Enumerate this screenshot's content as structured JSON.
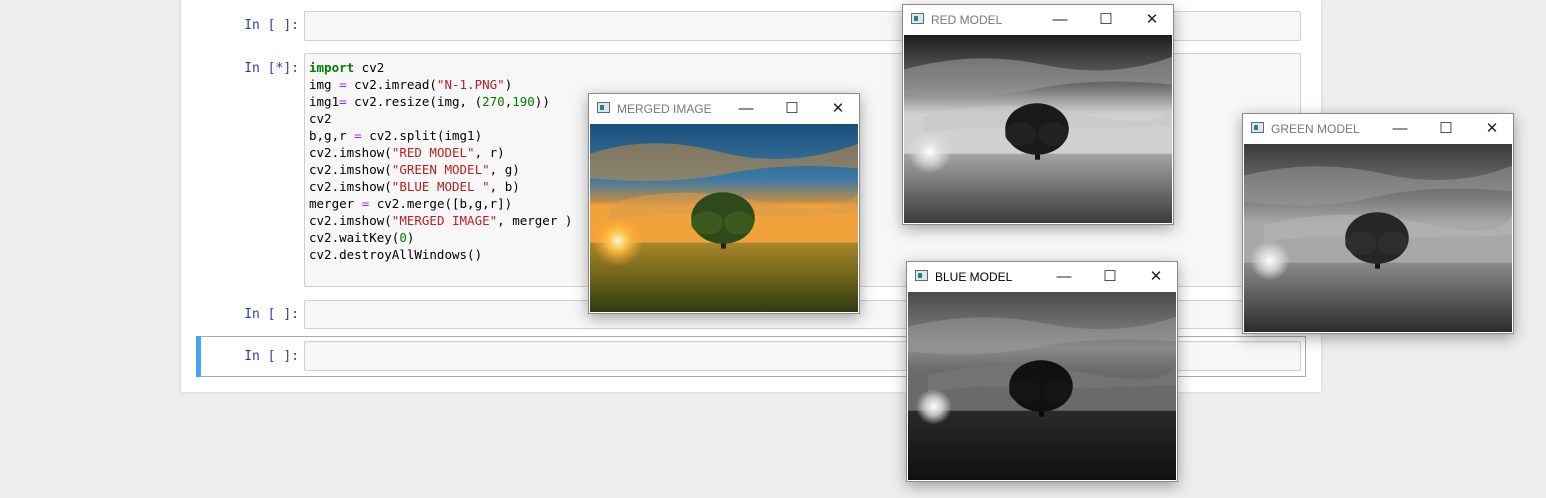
{
  "notebook": {
    "cells": [
      {
        "prompt": "In [ ]:"
      },
      {
        "prompt": "In [*]:",
        "code": [
          "import cv2",
          "img = cv2.imread(\"N-1.PNG\")",
          "img1= cv2.resize(img, (270,190))",
          "cv2",
          "b,g,r = cv2.split(img1)",
          "cv2.imshow(\"RED MODEL\", r)",
          "cv2.imshow(\"GREEN MODEL\", g)",
          "cv2.imshow(\"BLUE MODEL \", b)",
          "merger = cv2.merge([b,g,r])",
          "cv2.imshow(\"MERGED IMAGE\", merger )",
          "cv2.waitKey(0)",
          "cv2.destroyAllWindows()"
        ]
      },
      {
        "prompt": "In [ ]:"
      },
      {
        "prompt": "In [ ]:"
      }
    ]
  },
  "windows": {
    "merged": {
      "title": "MERGED IMAGE"
    },
    "red": {
      "title": "RED MODEL"
    },
    "green": {
      "title": "GREEN MODEL"
    },
    "blue": {
      "title": "BLUE MODEL"
    }
  },
  "window_controls": {
    "minimize": "—",
    "maximize": "☐",
    "close": "✕"
  }
}
